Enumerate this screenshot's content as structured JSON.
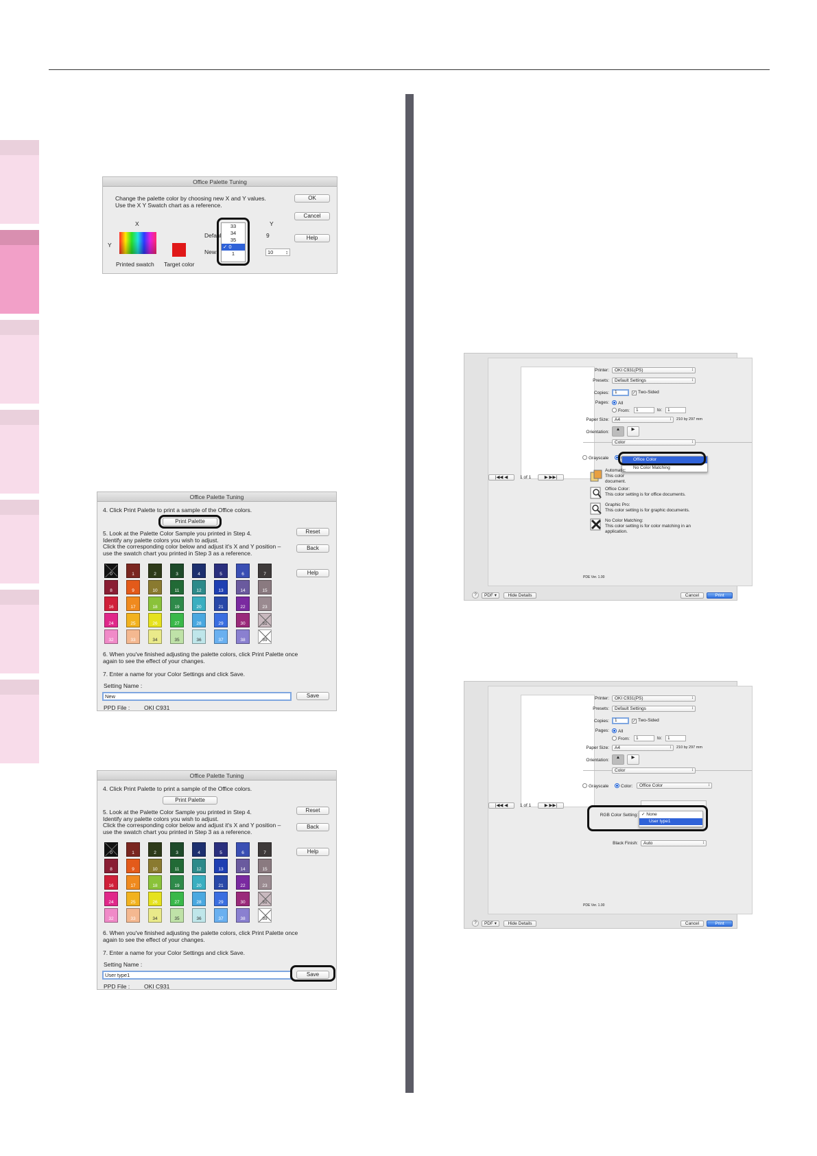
{
  "sidebar": {
    "tab_colors_light": "#f6d8e6",
    "tab_colors_header": "#ead0dc",
    "active_tab_color": "#f2a0c8"
  },
  "dialog1": {
    "title": "Office Palette Tuning",
    "instructions": "Change the palette color by choosing new X and Y values. Use the X Y Swatch chart as a reference.",
    "ok": "OK",
    "cancel": "Cancel",
    "help": "Help",
    "x_label": "X",
    "y_label": "Y",
    "y_label2": "Y",
    "default_label": "Defaul",
    "new_label": "New:",
    "y_default": "9",
    "y_new": "10",
    "printed_swatch": "Printed swatch",
    "target_color": "Target color",
    "list": [
      "33",
      "34",
      "35",
      "✓ 0",
      "1"
    ]
  },
  "dialog2": {
    "title": "Office Palette Tuning",
    "step4": "4. Click Print Palette to print a sample of the Office colors.",
    "print_palette": "Print Palette",
    "step5": [
      "5. Look at the Palette Color Sample you printed in Step 4.",
      "Identify any palette colors you wish to adjust.",
      "Click the corresponding color below and adjust it's X and Y position –",
      "use the swatch chart you printed in Step 3 as a reference."
    ],
    "reset": "Reset",
    "back": "Back",
    "help": "Help",
    "step6": [
      "6. When you've finished adjusting the palette colors, click Print Palette once",
      "again to see the effect of your changes."
    ],
    "step7": "7. Enter a name for your Color Settings and click Save.",
    "setting_name_label": "Setting Name :",
    "setting_name_value": "New",
    "save": "Save",
    "ppd_label": "PPD File :",
    "ppd_value": "OKI C931"
  },
  "dialog3": {
    "title": "Office Palette Tuning",
    "step4": "4. Click Print Palette to print a sample of the Office colors.",
    "print_palette": "Print Palette",
    "step5": [
      "5. Look at the Palette Color Sample you printed in Step 4.",
      "Identify any palette colors you wish to adjust.",
      "Click the corresponding color below and adjust it's X and Y position –",
      "use the swatch chart you printed in Step 3 as a reference."
    ],
    "reset": "Reset",
    "back": "Back",
    "help": "Help",
    "step6": [
      "6. When you've finished adjusting the palette colors, click Print Palette once",
      "again to see the effect of your changes."
    ],
    "step7": "7. Enter a name for your Color Settings and click Save.",
    "setting_name_label": "Setting Name :",
    "setting_name_value": "User type1",
    "save": "Save",
    "ppd_label": "PPD File :",
    "ppd_value": "OKI C931"
  },
  "palette": [
    {
      "n": "0",
      "c": "#111111",
      "x": true
    },
    {
      "n": "1",
      "c": "#7a2620"
    },
    {
      "n": "2",
      "c": "#2e3a1a"
    },
    {
      "n": "3",
      "c": "#1e4a2a"
    },
    {
      "n": "4",
      "c": "#1c2f6e"
    },
    {
      "n": "5",
      "c": "#2a2f7e"
    },
    {
      "n": "6",
      "c": "#3a4fb4"
    },
    {
      "n": "7",
      "c": "#3e3a3a"
    },
    {
      "n": "8",
      "c": "#8a1e34"
    },
    {
      "n": "9",
      "c": "#e35a1a"
    },
    {
      "n": "10",
      "c": "#8a7a30"
    },
    {
      "n": "11",
      "c": "#226a36"
    },
    {
      "n": "12",
      "c": "#2d8a8a"
    },
    {
      "n": "13",
      "c": "#1e3fb2"
    },
    {
      "n": "14",
      "c": "#6a5a9e"
    },
    {
      "n": "15",
      "c": "#8a7a80"
    },
    {
      "n": "16",
      "c": "#d0203a"
    },
    {
      "n": "17",
      "c": "#f08a1e"
    },
    {
      "n": "18",
      "c": "#8ac23a"
    },
    {
      "n": "19",
      "c": "#2e8a4a"
    },
    {
      "n": "20",
      "c": "#3aaec0"
    },
    {
      "n": "21",
      "c": "#2848a8"
    },
    {
      "n": "22",
      "c": "#7a2aa0"
    },
    {
      "n": "23",
      "c": "#9a8a90"
    },
    {
      "n": "24",
      "c": "#e0288a"
    },
    {
      "n": "25",
      "c": "#f2b21e"
    },
    {
      "n": "26",
      "c": "#e6e21e"
    },
    {
      "n": "27",
      "c": "#3ab84a"
    },
    {
      "n": "28",
      "c": "#4aa8e0"
    },
    {
      "n": "29",
      "c": "#3a6ee0"
    },
    {
      "n": "30",
      "c": "#9a2a7a"
    },
    {
      "n": "31",
      "c": "#c8b8be",
      "x": true,
      "lt": true
    },
    {
      "n": "32",
      "c": "#f08ac8"
    },
    {
      "n": "33",
      "c": "#f4b890"
    },
    {
      "n": "34",
      "c": "#eaea8a",
      "lt": true
    },
    {
      "n": "35",
      "c": "#bfe2a8",
      "lt": true
    },
    {
      "n": "36",
      "c": "#bfe6ea",
      "lt": true
    },
    {
      "n": "37",
      "c": "#6ab0f0"
    },
    {
      "n": "38",
      "c": "#8a80d0"
    },
    {
      "n": "39",
      "c": "#ffffff",
      "x": true,
      "lt": true
    }
  ],
  "print1": {
    "printer_label": "Printer:",
    "printer": "OKI C931(PS)",
    "presets_label": "Presets:",
    "presets": "Default Settings",
    "copies_label": "Copies:",
    "copies": "1",
    "two_sided": "Two-Sided",
    "pages_label": "Pages:",
    "all": "All",
    "from": "From:",
    "from_v": "1",
    "to": "to:",
    "to_v": "1",
    "paper_label": "Paper Size:",
    "paper": "A4",
    "paper_dim": "210 by 297 mm",
    "orient_label": "Orientation:",
    "section": "Color",
    "grayscale": "Grayscale",
    "color_short": "C",
    "menu": [
      "Office Color",
      "No Color Matching"
    ],
    "opt_auto": "Automatic:",
    "opt_auto_d1": "This color",
    "opt_auto_d2": "document.",
    "opt_office": "Office Color:",
    "opt_office_d": "This color setting is for office documents.",
    "opt_graphic": "Graphic Pro:",
    "opt_graphic_d": "This color setting is for graphic documents.",
    "opt_nomatch": "No Color Matching:",
    "opt_nomatch_d1": "This color setting is for color matching in an",
    "opt_nomatch_d2": "application.",
    "page_of": "1 of 1",
    "ppd_ver": "PDE Ver. 1.00",
    "help": "?",
    "pdf": "PDF ▾",
    "hide": "Hide Details",
    "cancel": "Cancel",
    "print": "Print"
  },
  "print2": {
    "printer_label": "Printer:",
    "printer": "OKI C931(PS)",
    "presets_label": "Presets:",
    "presets": "Default Settings",
    "copies_label": "Copies:",
    "copies": "1",
    "two_sided": "Two-Sided",
    "pages_label": "Pages:",
    "all": "All",
    "from": "From:",
    "from_v": "1",
    "to": "to:",
    "to_v": "1",
    "paper_label": "Paper Size:",
    "paper": "A4",
    "paper_dim": "210 by 297 mm",
    "orient_label": "Orientation:",
    "section": "Color",
    "grayscale": "Grayscale",
    "color_label": "Color:",
    "color_value": "Office Color",
    "rgb_label": "RGB Color Setting:",
    "rgb_options": [
      "✓ None",
      "User type1"
    ],
    "black_label": "Black Finish:",
    "black_value": "Auto",
    "page_of": "1 of 1",
    "ppd_ver": "PDE Ver. 1.00",
    "help": "?",
    "pdf": "PDF ▾",
    "hide": "Hide Details",
    "cancel": "Cancel",
    "print": "Print"
  }
}
